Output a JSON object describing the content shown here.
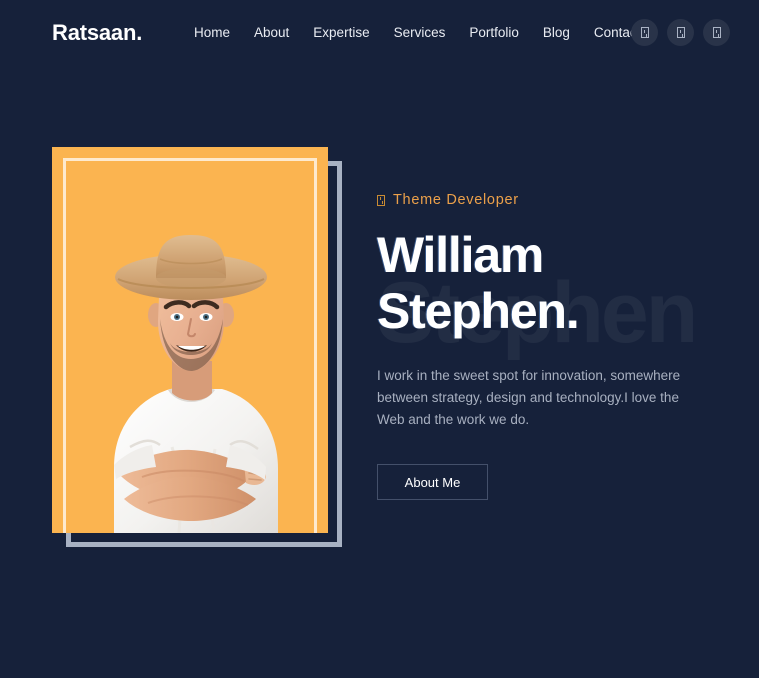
{
  "theme": {
    "background": "#16213a",
    "accent": "#eba04a",
    "card_orange": "#fbb450",
    "frame_grey": "#a8b2c3",
    "text_light": "#ffffff",
    "text_muted": "#a8b0c0",
    "social_bubble": "#293349"
  },
  "header": {
    "brand": "Ratsaan.",
    "nav": [
      {
        "label": "Home"
      },
      {
        "label": "About"
      },
      {
        "label": "Expertise"
      },
      {
        "label": "Services"
      },
      {
        "label": "Portfolio"
      },
      {
        "label": "Blog"
      },
      {
        "label": "Contact"
      }
    ],
    "social": [
      {
        "icon": "missing-glyph-box-icon",
        "glyph": "□"
      },
      {
        "icon": "missing-glyph-box-icon",
        "glyph": "□"
      },
      {
        "icon": "missing-glyph-box-icon",
        "glyph": "□"
      }
    ]
  },
  "hero": {
    "eyebrow": "Theme Developer",
    "eyebrow_icon": "missing-glyph-box-icon",
    "headline_line1": "William",
    "headline_line2": "Stephen.",
    "watermark": "Stephen",
    "description": "I work in the sweet spot for innovation, somewhere between strategy, design and technology.I love the Web and the work we do.",
    "cta_label": "About Me",
    "photo_alt": "Smiling man with straw hat and white t-shirt, arms crossed, on orange background"
  }
}
